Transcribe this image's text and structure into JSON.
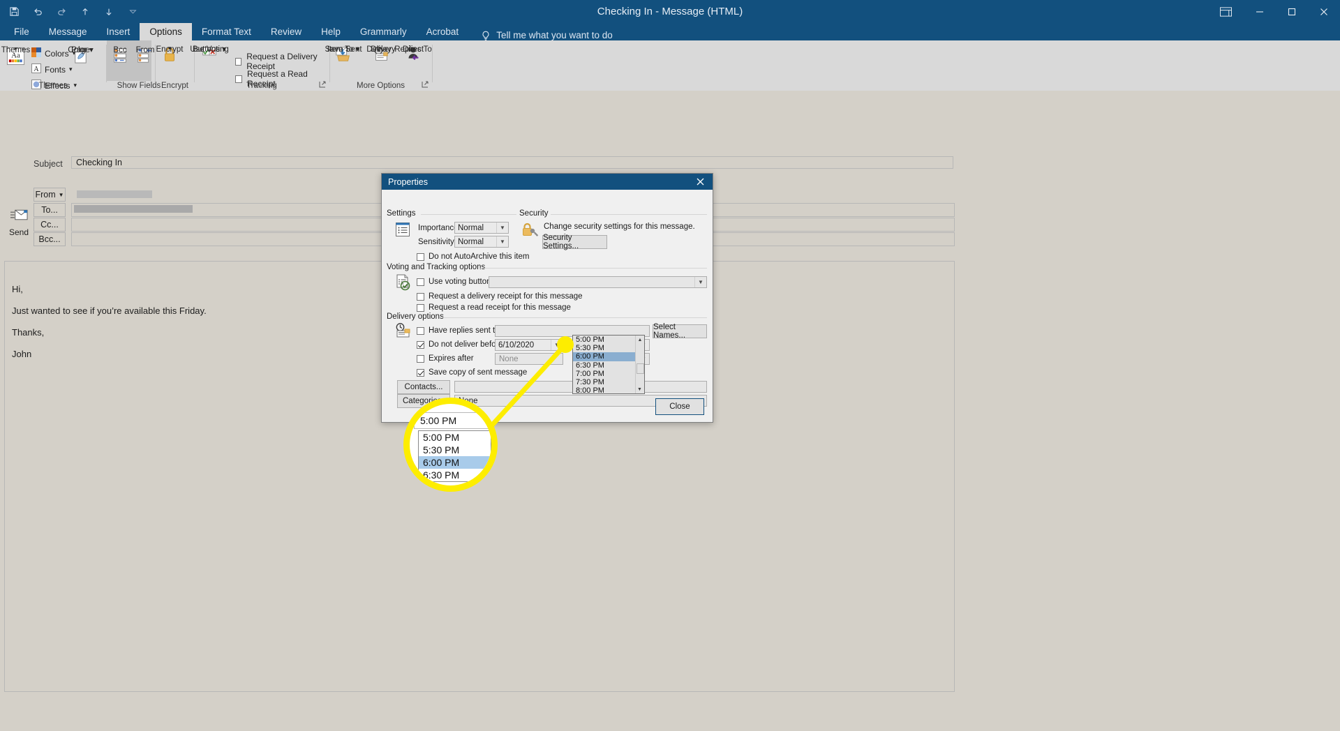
{
  "window": {
    "title": "Checking In  -  Message (HTML)",
    "quick_access": [
      "save-icon",
      "undo-icon",
      "redo-icon",
      "up-icon",
      "down-icon",
      "customize-qat-icon"
    ],
    "ribbon_display_options": "ribbon-display-options-icon",
    "minimize": "minimize-icon",
    "restore": "restore-icon",
    "close": "close-icon"
  },
  "tabs": [
    {
      "label": "File",
      "active": false
    },
    {
      "label": "Message",
      "active": false
    },
    {
      "label": "Insert",
      "active": false
    },
    {
      "label": "Options",
      "active": true
    },
    {
      "label": "Format Text",
      "active": false
    },
    {
      "label": "Review",
      "active": false
    },
    {
      "label": "Help",
      "active": false
    },
    {
      "label": "Grammarly",
      "active": false
    },
    {
      "label": "Acrobat",
      "active": false
    }
  ],
  "tell_me": {
    "icon": "lightbulb-icon",
    "label": "Tell me what you want to do"
  },
  "ribbon": {
    "groups": [
      {
        "name": "Themes",
        "label": "Themes"
      },
      {
        "name": "Show Fields",
        "label": "Show Fields"
      },
      {
        "name": "Encrypt",
        "label": "Encrypt"
      },
      {
        "name": "Tracking",
        "label": "Tracking"
      },
      {
        "name": "More Options",
        "label": "More Options"
      }
    ],
    "themes": {
      "themes_label": "Themes",
      "colors_label": "Colors",
      "fonts_label": "Fonts",
      "effects_label": "Effects",
      "page_color_label_1": "Page",
      "page_color_label_2": "Color"
    },
    "show_fields": {
      "bcc": "Bcc",
      "from": "From"
    },
    "encrypt": {
      "label": "Encrypt"
    },
    "tracking": {
      "use_voting_1": "Use Voting",
      "use_voting_2": "Buttons",
      "request_delivery_receipt": "Request a Delivery Receipt",
      "request_read_receipt": "Request a Read Receipt",
      "delivery_checked": false,
      "read_checked": false
    },
    "more_options": {
      "save_sent_1": "Save Sent",
      "save_sent_2": "Item To",
      "delay_1": "Delay",
      "delay_2": "Delivery",
      "direct_1": "Direct",
      "direct_2": "Replies To"
    }
  },
  "compose": {
    "send_label": "Send",
    "from_label": "From",
    "to_label": "To...",
    "cc_label": "Cc...",
    "bcc_label": "Bcc...",
    "subject_label": "Subject",
    "subject_value": "Checking In",
    "body_lines": [
      "Hi,",
      "Just wanted to see if you’re available this Friday.",
      "Thanks,",
      "John"
    ]
  },
  "dialog": {
    "title": "Properties",
    "close_icon": "close-icon",
    "settings": {
      "group_label": "Settings",
      "icon": "importance-settings-icon",
      "importance_label": "Importance",
      "importance_value": "Normal",
      "sensitivity_label": "Sensitivity",
      "sensitivity_value": "Normal",
      "autoarchive_label": "Do not AutoArchive this item",
      "autoarchive_checked": false
    },
    "security": {
      "group_label": "Security",
      "icon": "lock-key-icon",
      "description": "Change security settings for this message.",
      "button_label": "Security Settings..."
    },
    "voting": {
      "group_label": "Voting and Tracking options",
      "icon": "voting-ballot-icon",
      "use_voting_label": "Use voting buttons",
      "use_voting_checked": false,
      "use_voting_value": "",
      "delivery_receipt_label": "Request a delivery receipt for this message",
      "delivery_receipt_checked": false,
      "read_receipt_label": "Request a read receipt for this message",
      "read_receipt_checked": false
    },
    "delivery": {
      "group_label": "Delivery options",
      "icon": "clock-delivery-icon",
      "have_replies_label": "Have replies sent to",
      "have_replies_checked": false,
      "have_replies_value": "",
      "select_names_label": "Select Names...",
      "do_not_deliver_label": "Do not deliver before",
      "do_not_deliver_checked": true,
      "do_not_deliver_date": "6/10/2020",
      "do_not_deliver_time": "5:00 PM",
      "expires_after_label": "Expires after",
      "expires_after_checked": false,
      "expires_after_value": "None",
      "save_copy_label": "Save copy of sent message",
      "save_copy_checked": true,
      "contacts_label": "Contacts...",
      "contacts_value": "",
      "categories_label": "Categories",
      "categories_value": "None"
    },
    "close_button_label": "Close"
  },
  "time_dropdown": {
    "selected": "6:00 PM",
    "options": [
      "5:00 PM",
      "5:30 PM",
      "6:00 PM",
      "6:30 PM",
      "7:00 PM",
      "7:30 PM",
      "8:00 PM"
    ],
    "scroll_up_icon": "scroll-up-arrow-icon",
    "scroll_down_icon": "scroll-down-arrow-icon"
  },
  "magnifier": {
    "field_value": "5:00 PM",
    "rows": [
      "5:00 PM",
      "5:30 PM",
      "6:00 PM",
      "6:30 PM"
    ],
    "selected": "6:00 PM",
    "highlight_color": "#fded00"
  },
  "colors": {
    "accent": "#12507e",
    "ribbon_bg": "#d9d9d9",
    "app_bg": "#d4d0c8",
    "dialog_bg": "#f0f0f0",
    "selection": "#8aaed0",
    "callout": "#fded00"
  }
}
